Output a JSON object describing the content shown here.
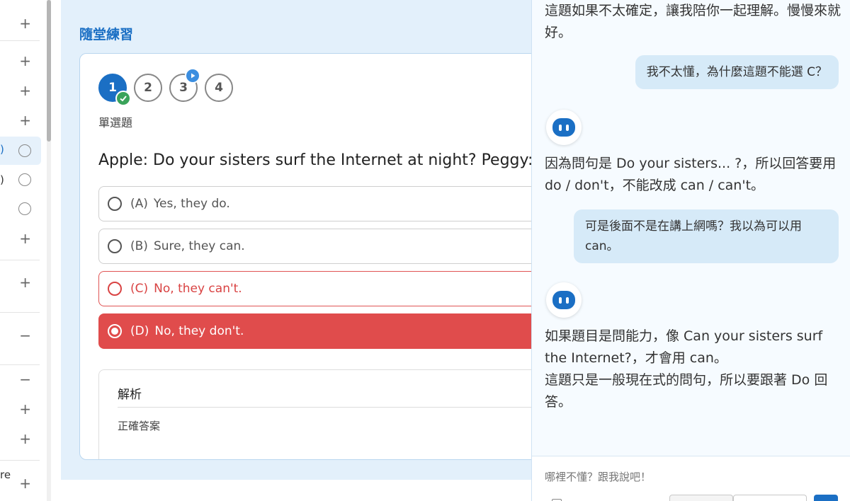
{
  "sidebar": {
    "fragments": [
      ")",
      ")",
      "re"
    ],
    "plus": "+",
    "minus": "−"
  },
  "practice": {
    "title": "隨堂練習",
    "steps": [
      "1",
      "2",
      "3",
      "4"
    ],
    "question_type": "單選題",
    "question": "Apple: Do your sisters surf the Internet at night? Peggy: ___",
    "options": [
      {
        "letter": "(A)",
        "text": "Yes, they do."
      },
      {
        "letter": "(B)",
        "text": "Sure, they can."
      },
      {
        "letter": "(C)",
        "text": "No, they can't."
      },
      {
        "letter": "(D)",
        "text": "No, they don't."
      }
    ],
    "analysis_title": "解析",
    "analysis_sub": "正確答案"
  },
  "chat": {
    "messages": [
      {
        "role": "bot",
        "text": "這題如果不太確定，讓我陪你一起理解。慢慢來就好。"
      },
      {
        "role": "user",
        "text": "我不太懂，為什麼這題不能選 C？"
      },
      {
        "role": "bot",
        "text": "因為問句是 Do your sisters... ?，所以回答要用 do / don't，不能改成 can / can't。"
      },
      {
        "role": "user",
        "text": "可是後面不是在講上網嗎？我以為可以用 can。"
      },
      {
        "role": "bot",
        "text": "如果題目是問能力，像 Can your sisters surf the Internet?，才會用 can。"
      },
      {
        "role": "bot",
        "text": " 這題只是一般現在式的問句，所以要跟著 Do 回答。"
      }
    ],
    "input_placeholder": "哪裡不懂？跟我說吧！"
  },
  "colors": {
    "accent": "#1b6fc4",
    "wrong": "#e04c4c",
    "correct": "#3aa35a"
  }
}
